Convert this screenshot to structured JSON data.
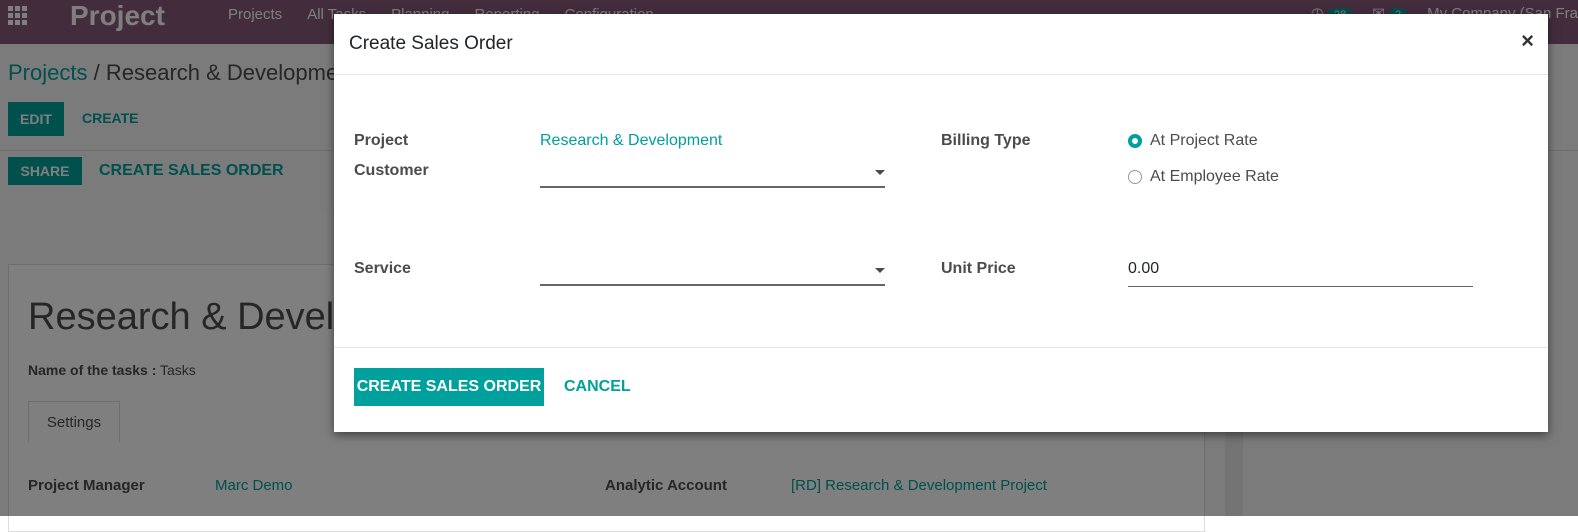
{
  "app": {
    "brand": "Project",
    "menu": [
      "Projects",
      "All Tasks",
      "Planning",
      "Reporting",
      "Configuration"
    ],
    "activity_count": "28",
    "message_count": "2",
    "company": "My Company (San Fra"
  },
  "background": {
    "breadcrumb_root": "Projects",
    "breadcrumb_separator": "/",
    "breadcrumb_current": "Research & Developme",
    "edit_label": "EDIT",
    "create_label": "CREATE",
    "share_label": "SHARE",
    "create_sales_order_label": "CREATE SALES ORDER",
    "record_title": "Research & Develo",
    "tasks_name_label": "Name of the tasks :",
    "tasks_name_value": "Tasks",
    "settings_tab": "Settings",
    "project_manager_label": "Project Manager",
    "project_manager_value": "Marc Demo",
    "analytic_account_label": "Analytic Account",
    "analytic_account_value": "[RD] Research & Development Project"
  },
  "dialog": {
    "title": "Create Sales Order",
    "close_glyph": "×",
    "project_label": "Project",
    "project_value": "Research & Development",
    "customer_label": "Customer",
    "customer_value": "",
    "service_label": "Service",
    "service_value": "",
    "billing_type_label": "Billing Type",
    "billing_options": [
      "At Project Rate",
      "At Employee Rate"
    ],
    "billing_selected": "At Project Rate",
    "unit_price_label": "Unit Price",
    "unit_price_value": "0.00",
    "create_button": "CREATE SALES ORDER",
    "cancel_button": "CANCEL"
  },
  "colors": {
    "navbar": "#875a7b",
    "accent": "#00a09d"
  }
}
